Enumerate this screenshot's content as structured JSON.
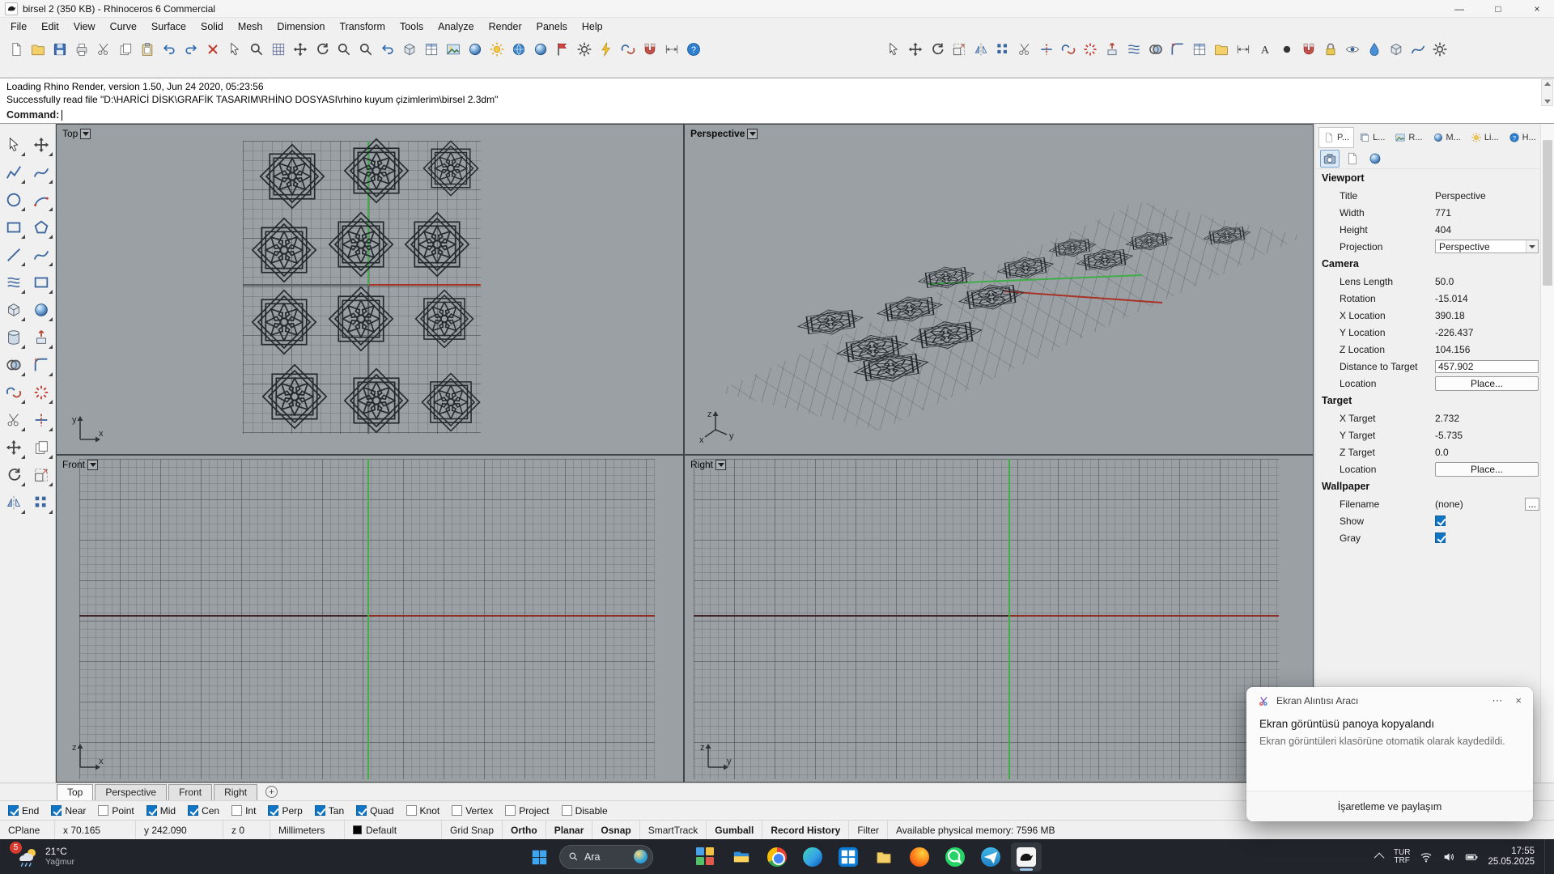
{
  "titlebar": {
    "title": "birsel 2 (350 KB) - Rhinoceros 6 Commercial",
    "minimize": "—",
    "maximize": "□",
    "close": "×"
  },
  "menu": {
    "items": [
      "File",
      "Edit",
      "View",
      "Curve",
      "Surface",
      "Solid",
      "Mesh",
      "Dimension",
      "Transform",
      "Tools",
      "Analyze",
      "Render",
      "Panels",
      "Help"
    ]
  },
  "toolbar_main": {
    "icons": [
      {
        "name": "new-file",
        "sym": "doc"
      },
      {
        "name": "open-file",
        "sym": "folder"
      },
      {
        "name": "save",
        "sym": "disk"
      },
      {
        "name": "print",
        "sym": "printer"
      },
      {
        "name": "cut",
        "sym": "scissors"
      },
      {
        "name": "copy",
        "sym": "copy"
      },
      {
        "name": "paste",
        "sym": "clipboard"
      },
      {
        "name": "undo",
        "sym": "undo"
      },
      {
        "name": "redo",
        "sym": "redo"
      },
      {
        "name": "delete",
        "sym": "cross"
      },
      {
        "name": "select",
        "sym": "pointer"
      },
      {
        "name": "zoom-window",
        "sym": "zoom"
      },
      {
        "name": "zoom-extents",
        "sym": "grid"
      },
      {
        "name": "pan",
        "sym": "pan"
      },
      {
        "name": "rotate-view",
        "sym": "rotate"
      },
      {
        "name": "zoom-in",
        "sym": "zoom"
      },
      {
        "name": "zoom-out",
        "sym": "zoom"
      },
      {
        "name": "undo-view",
        "sym": "undo"
      },
      {
        "name": "place-box",
        "sym": "cube"
      },
      {
        "name": "layout",
        "sym": "table"
      },
      {
        "name": "render",
        "sym": "photo"
      },
      {
        "name": "render-preview",
        "sym": "sphere"
      },
      {
        "name": "sun-study",
        "sym": "sun"
      },
      {
        "name": "earth-anchor",
        "sym": "globe"
      },
      {
        "name": "shaded-view",
        "sym": "sphere"
      },
      {
        "name": "flag",
        "sym": "flag"
      },
      {
        "name": "options",
        "sym": "gear"
      },
      {
        "name": "lightning",
        "sym": "light"
      },
      {
        "name": "link",
        "sym": "join"
      },
      {
        "name": "magnet",
        "sym": "magnet"
      },
      {
        "name": "dimension",
        "sym": "dim"
      },
      {
        "name": "help",
        "sym": "help"
      }
    ]
  },
  "toolbar_right": {
    "icons": [
      {
        "name": "pointer",
        "sym": "pointer"
      },
      {
        "name": "move",
        "sym": "pan"
      },
      {
        "name": "rotate",
        "sym": "rotate"
      },
      {
        "name": "scale",
        "sym": "scale"
      },
      {
        "name": "mirror",
        "sym": "mirror"
      },
      {
        "name": "array",
        "sym": "array"
      },
      {
        "name": "trim",
        "sym": "scissors"
      },
      {
        "name": "split",
        "sym": "split"
      },
      {
        "name": "join",
        "sym": "join"
      },
      {
        "name": "explode",
        "sym": "explode"
      },
      {
        "name": "extrude",
        "sym": "extrude"
      },
      {
        "name": "loft",
        "sym": "loft"
      },
      {
        "name": "boolean",
        "sym": "boolean"
      },
      {
        "name": "fillet",
        "sym": "fillet"
      },
      {
        "name": "grid-table",
        "sym": "table"
      },
      {
        "name": "open-panel",
        "sym": "folder"
      },
      {
        "name": "dimension",
        "sym": "dim"
      },
      {
        "name": "text",
        "sym": "text"
      },
      {
        "name": "point",
        "sym": "dot"
      },
      {
        "name": "osnap-magnet",
        "sym": "magnet"
      },
      {
        "name": "lock",
        "sym": "lock"
      },
      {
        "name": "visibility",
        "sym": "eye"
      },
      {
        "name": "paint",
        "sym": "paint"
      },
      {
        "name": "box",
        "sym": "cube"
      },
      {
        "name": "curve-tools",
        "sym": "curve"
      },
      {
        "name": "settings",
        "sym": "gear"
      }
    ]
  },
  "sidebar": {
    "icons": [
      {
        "name": "select",
        "sym": "pointer"
      },
      {
        "name": "move",
        "sym": "pan"
      },
      {
        "name": "polyline",
        "sym": "polyline"
      },
      {
        "name": "curve",
        "sym": "curve"
      },
      {
        "name": "circle",
        "sym": "circle"
      },
      {
        "name": "arc",
        "sym": "arc"
      },
      {
        "name": "rectangle",
        "sym": "rectsh"
      },
      {
        "name": "polygon",
        "sym": "polygon"
      },
      {
        "name": "line",
        "sym": "line"
      },
      {
        "name": "freeform",
        "sym": "curve"
      },
      {
        "name": "surface",
        "sym": "loft"
      },
      {
        "name": "plane",
        "sym": "rectsh"
      },
      {
        "name": "box",
        "sym": "cube"
      },
      {
        "name": "sphere",
        "sym": "sphere"
      },
      {
        "name": "cylinder",
        "sym": "cylinder"
      },
      {
        "name": "extrude",
        "sym": "extrude"
      },
      {
        "name": "boolean",
        "sym": "boolean"
      },
      {
        "name": "fillet",
        "sym": "fillet"
      },
      {
        "name": "join",
        "sym": "join"
      },
      {
        "name": "explode",
        "sym": "explode"
      },
      {
        "name": "trim",
        "sym": "scissors"
      },
      {
        "name": "split",
        "sym": "split"
      },
      {
        "name": "move-obj",
        "sym": "pan"
      },
      {
        "name": "copy-obj",
        "sym": "copy"
      },
      {
        "name": "rotate-obj",
        "sym": "rotate"
      },
      {
        "name": "scale-obj",
        "sym": "scale"
      },
      {
        "name": "mirror-obj",
        "sym": "mirror"
      },
      {
        "name": "array-obj",
        "sym": "array"
      }
    ]
  },
  "command": {
    "history1": "Loading Rhino Render, version 1.50, Jun 24 2020, 05:23:56",
    "history2": "Successfully read file \"D:\\HARİCİ DİSK\\GRAFİK TASARIM\\RHİNO DOSYASI\\rhino kuyum çizimlerim\\birsel 2.3dm\"",
    "prompt": "Command:"
  },
  "viewports": {
    "top": "Top",
    "perspective": "Perspective",
    "front": "Front",
    "right": "Right"
  },
  "axes": {
    "x": "x",
    "y": "y",
    "z": "z"
  },
  "panel": {
    "tabs": [
      {
        "label": "P...",
        "name": "properties",
        "sym": "page",
        "active": true
      },
      {
        "label": "L...",
        "name": "layers",
        "sym": "layers"
      },
      {
        "label": "R...",
        "name": "rendering",
        "sym": "photo"
      },
      {
        "label": "M...",
        "name": "materials",
        "sym": "sphere"
      },
      {
        "label": "Li...",
        "name": "lights",
        "sym": "sun"
      },
      {
        "label": "H...",
        "name": "help",
        "sym": "help"
      }
    ],
    "viewport": {
      "header": "Viewport",
      "title_label": "Title",
      "title_value": "Perspective",
      "width_label": "Width",
      "width_value": "771",
      "height_label": "Height",
      "height_value": "404",
      "projection_label": "Projection",
      "projection_value": "Perspective"
    },
    "camera": {
      "header": "Camera",
      "lens_label": "Lens Length",
      "lens_value": "50.0",
      "rotation_label": "Rotation",
      "rotation_value": "-15.014",
      "x_label": "X Location",
      "x_value": "390.18",
      "y_label": "Y Location",
      "y_value": "-226.437",
      "z_label": "Z Location",
      "z_value": "104.156",
      "distance_label": "Distance to Target",
      "distance_value": "457.902",
      "location_label": "Location",
      "place_label": "Place..."
    },
    "target": {
      "header": "Target",
      "x_label": "X Target",
      "x_value": "2.732",
      "y_label": "Y Target",
      "y_value": "-5.735",
      "z_label": "Z Target",
      "z_value": "0.0",
      "location_label": "Location",
      "place_label": "Place..."
    },
    "wallpaper": {
      "header": "Wallpaper",
      "filename_label": "Filename",
      "filename_value": "(none)",
      "more_label": "...",
      "show_label": "Show",
      "gray_label": "Gray"
    }
  },
  "viewport_tabs": {
    "add": "+",
    "items": [
      {
        "label": "Top",
        "name": "top",
        "active": true
      },
      {
        "label": "Perspective",
        "name": "perspective"
      },
      {
        "label": "Front",
        "name": "front"
      },
      {
        "label": "Right",
        "name": "right"
      }
    ]
  },
  "osnap": {
    "items": [
      {
        "label": "End",
        "name": "end",
        "checked": true
      },
      {
        "label": "Near",
        "name": "near",
        "checked": true
      },
      {
        "label": "Point",
        "name": "point"
      },
      {
        "label": "Mid",
        "name": "mid",
        "checked": true
      },
      {
        "label": "Cen",
        "name": "cen",
        "checked": true
      },
      {
        "label": "Int",
        "name": "int"
      },
      {
        "label": "Perp",
        "name": "perp",
        "checked": true
      },
      {
        "label": "Tan",
        "name": "tan",
        "checked": true
      },
      {
        "label": "Quad",
        "name": "quad",
        "checked": true
      },
      {
        "label": "Knot",
        "name": "knot"
      },
      {
        "label": "Vertex",
        "name": "vertex"
      },
      {
        "label": "Project",
        "name": "project"
      },
      {
        "label": "Disable",
        "name": "disable"
      }
    ]
  },
  "statusbar": {
    "cplane": "CPlane",
    "x": "x 70.165",
    "y": "y 242.090",
    "z": "z 0",
    "units": "Millimeters",
    "layer": "Default",
    "toggles": [
      {
        "label": "Grid Snap",
        "name": "grid-snap"
      },
      {
        "label": "Ortho",
        "name": "ortho",
        "bold": true
      },
      {
        "label": "Planar",
        "name": "planar",
        "bold": true
      },
      {
        "label": "Osnap",
        "name": "osnap",
        "bold": true
      },
      {
        "label": "SmartTrack",
        "name": "smarttrack"
      },
      {
        "label": "Gumball",
        "name": "gumball",
        "bold": true
      },
      {
        "label": "Record History",
        "name": "record-history",
        "bold": true
      },
      {
        "label": "Filter",
        "name": "filter"
      }
    ],
    "memory": "Available physical memory: 7596 MB"
  },
  "taskbar": {
    "weather_temp": "21°C",
    "weather_desc": "Yağmur",
    "badge": "5",
    "search": "Ara",
    "apps": [
      "widgets",
      "file-explorer",
      "chrome",
      "edge",
      "store",
      "folder",
      "firefox",
      "whatsapp",
      "messaging",
      "rhino"
    ],
    "tray": {
      "lang1": "TUR",
      "lang2": "TRF",
      "time": "17:55",
      "date": "25.05.2025"
    }
  },
  "notification": {
    "app": "Ekran Alıntısı Aracı",
    "more": "⋯",
    "close": "×",
    "line1": "Ekran görüntüsü panoya kopyalandı",
    "line2": "Ekran görüntüleri klasörüne otomatik olarak kaydedildi.",
    "action": "İşaretleme ve paylaşım"
  },
  "colors": {
    "accent": "#1075c4",
    "viewport_bg": "#9aa0a4",
    "axis_red": "#a93226",
    "axis_green": "#3fae49",
    "taskbar": "#21242a"
  }
}
